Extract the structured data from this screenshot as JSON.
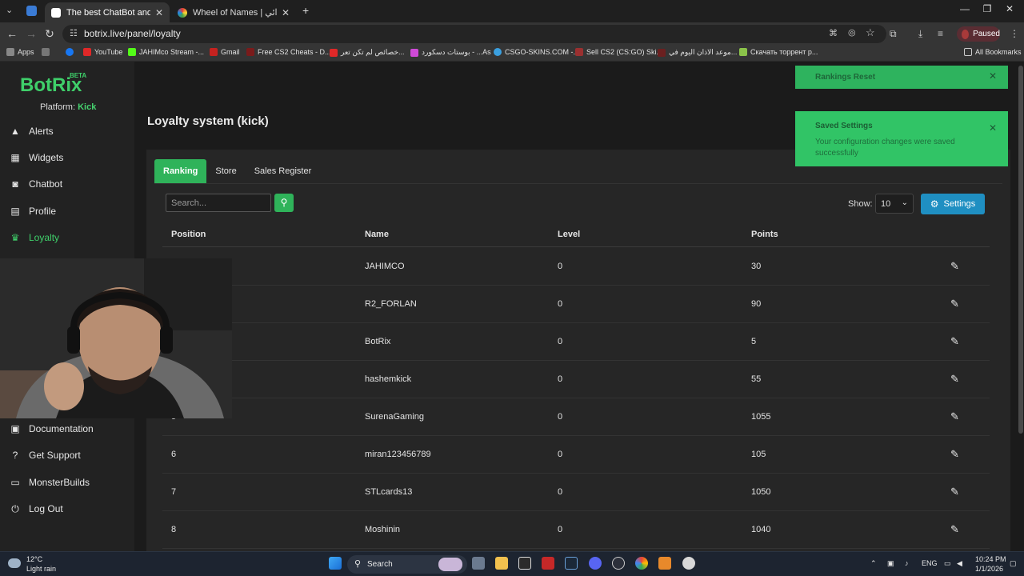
{
  "browser": {
    "tabs": [
      {
        "title": "The best ChatBot and Widgets",
        "active": true
      },
      {
        "title": "Wheel of Names | سم العشوائي",
        "active": false
      }
    ],
    "new_tab": "+",
    "url": "botrix.live/panel/loyalty",
    "profile_status": "Paused",
    "bookmarks": [
      "Apps",
      "YouTube",
      "JAHIMco Stream -...",
      "Gmail",
      "Free CS2 Cheats - D...",
      "خصائص لم تكن تعر...",
      "بوستات دسكورد - ...As",
      "CSGO-SKINS.COM -...",
      "Sell CS2 (CS:GO) Ski...",
      "موعد الاذان اليوم في...",
      "Скачать торрент р..."
    ],
    "all_bookmarks": "All Bookmarks"
  },
  "sidebar": {
    "logo": "BotRix",
    "beta": "BETA",
    "platform_label": "Platform:",
    "platform_value": "Kick",
    "items": [
      {
        "label": "Alerts",
        "icon": "warning-icon"
      },
      {
        "label": "Widgets",
        "icon": "grid-icon"
      },
      {
        "label": "Chatbot",
        "icon": "robot-icon"
      },
      {
        "label": "Profile",
        "icon": "id-card-icon"
      },
      {
        "label": "Loyalty",
        "icon": "trophy-icon",
        "active": true
      },
      {
        "label": "Documentation",
        "icon": "book-icon"
      },
      {
        "label": "Get Support",
        "icon": "help-icon"
      },
      {
        "label": "MonsterBuilds",
        "icon": "laptop-icon"
      },
      {
        "label": "Log Out",
        "icon": "power-icon"
      }
    ]
  },
  "main": {
    "title": "Loyalty system (kick)",
    "tabs": [
      "Ranking",
      "Store",
      "Sales Register"
    ],
    "search_placeholder": "Search...",
    "show_label": "Show:",
    "show_value": "10",
    "settings_label": "Settings",
    "columns": [
      "Position",
      "Name",
      "Level",
      "Points"
    ],
    "rows": [
      {
        "position": "",
        "name": "JAHIMCO",
        "level": "0",
        "points": "30"
      },
      {
        "position": "",
        "name": "R2_FORLAN",
        "level": "0",
        "points": "90"
      },
      {
        "position": "",
        "name": "BotRix",
        "level": "0",
        "points": "5"
      },
      {
        "position": "",
        "name": "hashemkick",
        "level": "0",
        "points": "55"
      },
      {
        "position": "5",
        "name": "SurenaGaming",
        "level": "0",
        "points": "1055"
      },
      {
        "position": "6",
        "name": "miran123456789",
        "level": "0",
        "points": "105"
      },
      {
        "position": "7",
        "name": "STLcards13",
        "level": "0",
        "points": "1050"
      },
      {
        "position": "8",
        "name": "Moshinin",
        "level": "0",
        "points": "1040"
      }
    ]
  },
  "toasts": [
    {
      "title": "Rankings Reset",
      "message": ""
    },
    {
      "title": "Saved Settings",
      "message": "Your configuration changes were saved successfully"
    }
  ],
  "taskbar": {
    "temperature": "12°C",
    "weather": "Light rain",
    "search": "Search",
    "language": "ENG",
    "time": "10:24 PM",
    "date": "1/1/2026"
  },
  "colors": {
    "accent": "#2fb35a",
    "settings_button": "#1f8fc2",
    "toast": "#31c466"
  }
}
